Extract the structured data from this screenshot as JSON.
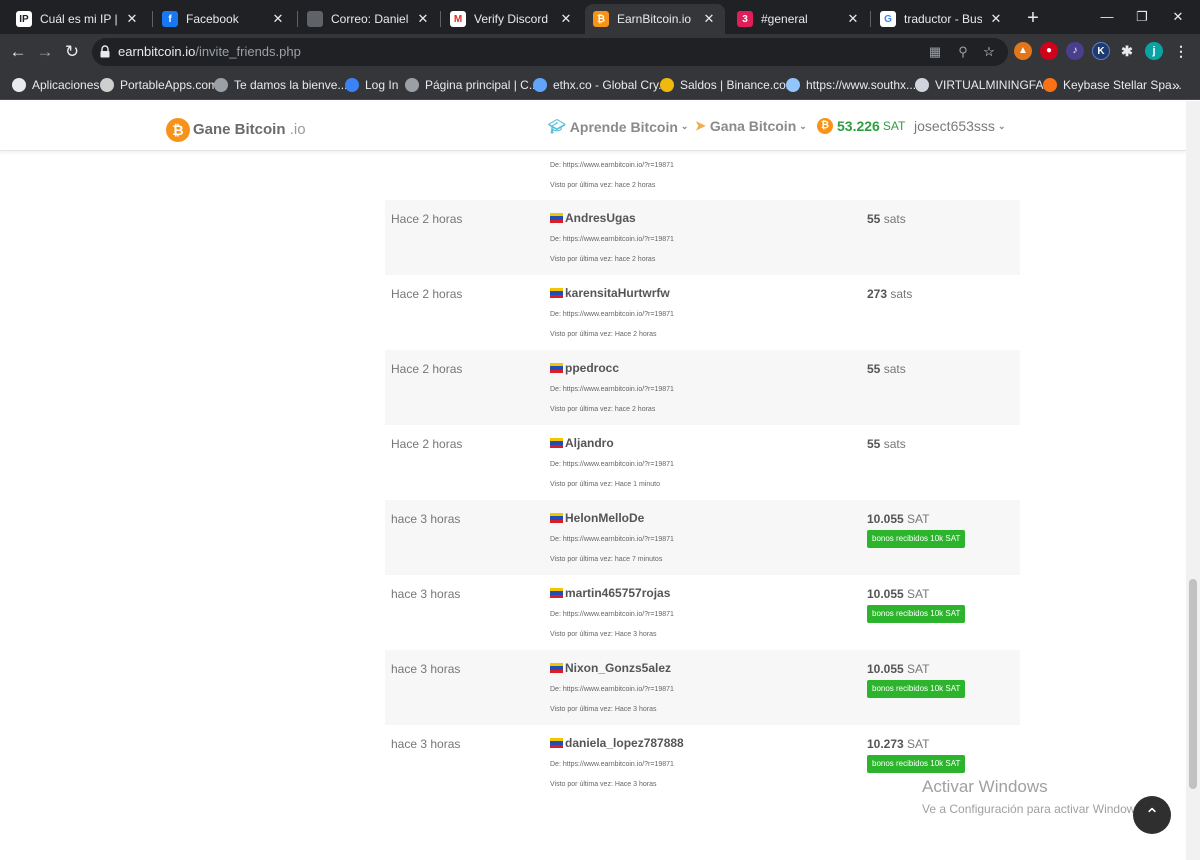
{
  "browser": {
    "tabs": [
      {
        "title": "Cuál es mi IP | Cómo",
        "fav_text": "IP",
        "fav_color": "#ffffff",
        "fav_text_color": "#202124"
      },
      {
        "title": "Facebook",
        "fav_text": "f",
        "fav_color": "#1877f2",
        "fav_text_color": "#ffffff"
      },
      {
        "title": "Correo: Daniela lope",
        "fav_text": "",
        "fav_color": "#5f6368",
        "fav_text_color": "#ffffff"
      },
      {
        "title": "Verify Discord Login",
        "fav_text": "M",
        "fav_color": "#ffffff",
        "fav_text_color": "#d93025"
      },
      {
        "title": "EarnBitcoin.io | Pag",
        "fav_text": "₿",
        "fav_color": "#f7931a",
        "fav_text_color": "#ffffff"
      },
      {
        "title": "#general",
        "fav_text": "3",
        "fav_color": "#e01e5a",
        "fav_text_color": "#ffffff"
      },
      {
        "title": "traductor - Buscar c",
        "fav_text": "G",
        "fav_color": "#ffffff",
        "fav_text_color": "#4285f4"
      }
    ],
    "active_tab": 4,
    "url_host": "earnbitcoin.io",
    "url_path": "/invite_friends.php",
    "profile_initial": "j",
    "bookmarks": [
      {
        "label": "Aplicaciones",
        "color": "#e8eaed"
      },
      {
        "label": "PortableApps.com",
        "color": "#cfcfcf"
      },
      {
        "label": "Te damos la bienve...",
        "color": "#9aa0a6"
      },
      {
        "label": "Log In",
        "color": "#3b82f6"
      },
      {
        "label": "Página principal | C...",
        "color": "#9aa0a6"
      },
      {
        "label": "ethx.co - Global Cry...",
        "color": "#60a5fa"
      },
      {
        "label": "Saldos | Binance.com",
        "color": "#f0b90b"
      },
      {
        "label": "https://www.southx...",
        "color": "#93c5fd"
      },
      {
        "label": "VIRTUALMININGFA...",
        "color": "#d1d5db"
      },
      {
        "label": "Keybase Stellar Spa...",
        "color": "#f97316"
      }
    ]
  },
  "site": {
    "logo_name": "Gane Bitcoin",
    "logo_suffix": ".io",
    "nav_learn": "Aprende Bitcoin",
    "nav_earn": "Gana Bitcoin",
    "balance": "53.226",
    "balance_unit": "SAT",
    "username": "josect653sss"
  },
  "partial_row": {
    "from": "De: https://www.earnbitcoin.io/?r=19871",
    "seen": "Visto por última vez: hace 2 horas"
  },
  "referrals": [
    {
      "when": "Hace 2 horas",
      "name": "AndresUgas",
      "from": "De: https://www.earnbitcoin.io/?r=19871",
      "seen": "Visto por última vez: hace 2 horas",
      "amount": "55",
      "unit": "sats",
      "badge": ""
    },
    {
      "when": "Hace 2 horas",
      "name": "karensitaHurtwrfw",
      "from": "De: https://www.earnbitcoin.io/?r=19871",
      "seen": "Visto por última vez: Hace 2 horas",
      "amount": "273",
      "unit": "sats",
      "badge": ""
    },
    {
      "when": "Hace 2 horas",
      "name": "ppedrocc",
      "from": "De: https://www.earnbitcoin.io/?r=19871",
      "seen": "Visto por última vez: hace 2 horas",
      "amount": "55",
      "unit": "sats",
      "badge": ""
    },
    {
      "when": "Hace 2 horas",
      "name": "Aljandro",
      "from": "De: https://www.earnbitcoin.io/?r=19871",
      "seen": "Visto por última vez: Hace 1 minuto",
      "amount": "55",
      "unit": "sats",
      "badge": ""
    },
    {
      "when": "hace 3 horas",
      "name": "HelonMelloDe",
      "from": "De: https://www.earnbitcoin.io/?r=19871",
      "seen": "Visto por última vez: hace 7 minutos",
      "amount": "10.055",
      "unit": "SAT",
      "badge": "bonos recibidos 10k SAT"
    },
    {
      "when": "hace 3 horas",
      "name": "martin465757rojas",
      "from": "De: https://www.earnbitcoin.io/?r=19871",
      "seen": "Visto por última vez: Hace 3 horas",
      "amount": "10.055",
      "unit": "SAT",
      "badge": "bonos recibidos 10k SAT"
    },
    {
      "when": "hace 3 horas",
      "name": "Nixon_Gonzs5alez",
      "from": "De: https://www.earnbitcoin.io/?r=19871",
      "seen": "Visto por última vez: Hace 3 horas",
      "amount": "10.055",
      "unit": "SAT",
      "badge": "bonos recibidos 10k SAT"
    },
    {
      "when": "hace 3 horas",
      "name": "daniela_lopez787888",
      "from": "De: https://www.earnbitcoin.io/?r=19871",
      "seen": "Visto por última vez: Hace 3 horas",
      "amount": "10.273",
      "unit": "SAT",
      "badge": "bonos recibidos 10k SAT"
    }
  ],
  "flag_colors": [
    "#f4c400",
    "#1f4fb5",
    "#d81e2a"
  ],
  "watermark": {
    "title": "Activar Windows",
    "subtitle": "Ve a Configuración para activar Windows."
  }
}
